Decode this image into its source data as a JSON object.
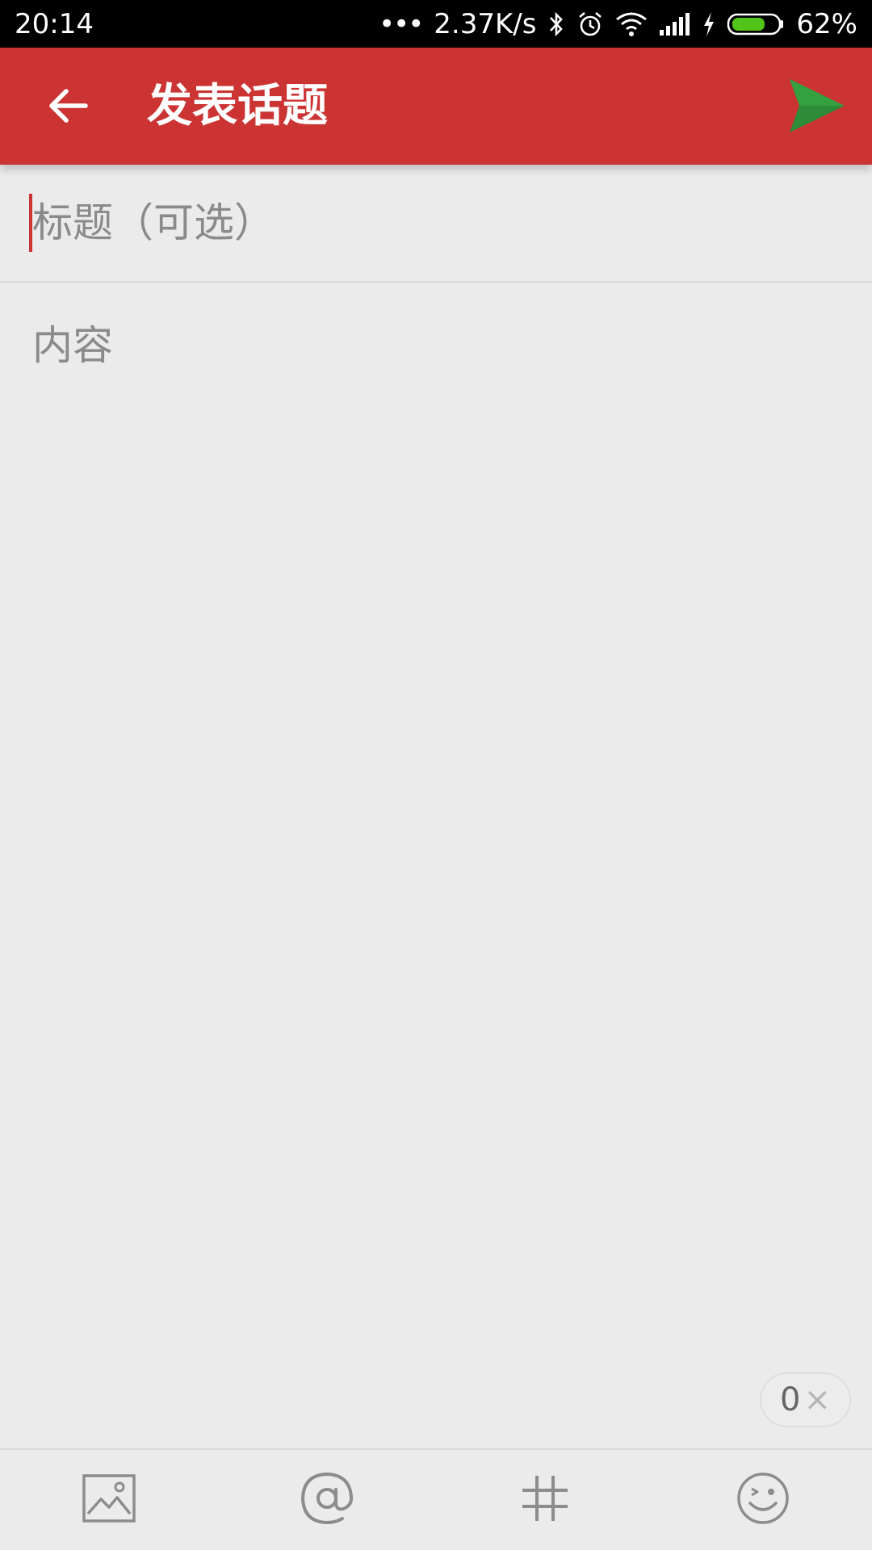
{
  "status_bar": {
    "time": "20:14",
    "net_speed": "2.37K/s",
    "battery": "62%",
    "icons": [
      "more-dots-icon",
      "bluetooth-icon",
      "alarm-icon",
      "wifi-icon",
      "signal-icon",
      "charging-icon",
      "battery-icon"
    ]
  },
  "app_bar": {
    "title": "发表话题",
    "back_icon": "arrow-left-icon",
    "send_icon": "send-icon"
  },
  "form": {
    "title_placeholder": "标题（可选）",
    "content_placeholder": "内容"
  },
  "counter": {
    "value": "0",
    "clear_symbol": "×"
  },
  "toolbar": {
    "items": [
      "image-icon",
      "at-icon",
      "hashtag-icon",
      "emoji-icon"
    ]
  },
  "colors": {
    "app_bar": "#cc3333",
    "send_icon": "#2e8b37",
    "background": "#ebebeb",
    "placeholder": "#8a8a8a"
  }
}
